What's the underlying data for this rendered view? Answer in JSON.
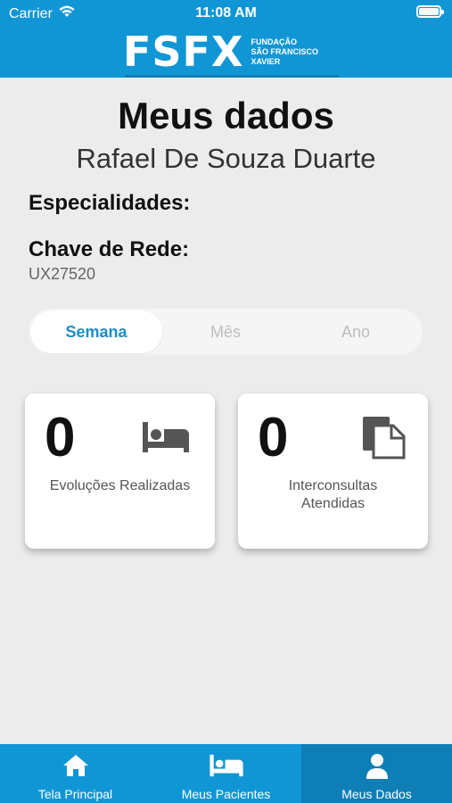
{
  "status": {
    "carrier": "Carrier",
    "time": "11:08 AM"
  },
  "header": {
    "logo_text": "FSFX",
    "logo_sub": [
      "FUNDAÇÃO",
      "SÃO FRANCISCO",
      "XAVIER"
    ]
  },
  "profile": {
    "title": "Meus dados",
    "name": "Rafael De Souza Duarte",
    "specialties_label": "Especialidades:",
    "network_key_label": "Chave de Rede:",
    "network_key_value": "UX27520"
  },
  "period_tabs": [
    {
      "label": "Semana",
      "active": true
    },
    {
      "label": "Mês",
      "active": false
    },
    {
      "label": "Ano",
      "active": false
    }
  ],
  "stats": [
    {
      "count": "0",
      "caption": "Evoluções Realizadas",
      "icon": "bed-icon"
    },
    {
      "count": "0",
      "caption_line1": "Interconsultas",
      "caption_line2": "Atendidas",
      "icon": "documents-icon"
    }
  ],
  "tabbar": [
    {
      "label": "Tela Principal",
      "icon": "home-icon",
      "active": false
    },
    {
      "label": "Meus Pacientes",
      "icon": "bed-icon",
      "active": false
    },
    {
      "label": "Meus Dados",
      "icon": "user-icon",
      "active": true
    }
  ],
  "colors": {
    "brand": "#1196d5",
    "brand_dark": "#0e7fb6",
    "accent_text": "#1a8fc8",
    "background": "#ececec"
  }
}
